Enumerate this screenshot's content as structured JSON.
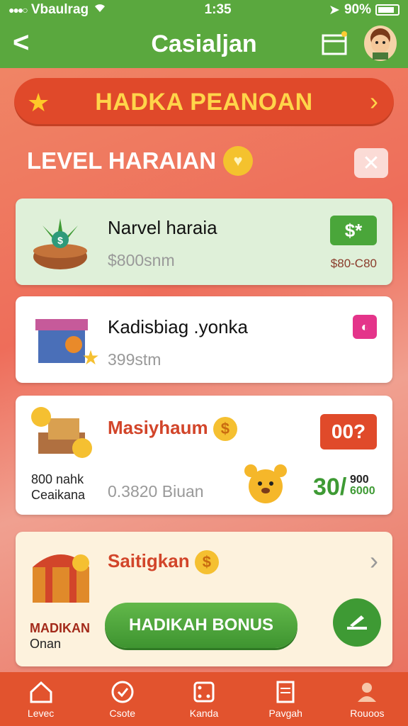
{
  "status": {
    "carrier": "Vbaulrag",
    "time": "1:35",
    "battery": "90%"
  },
  "nav": {
    "back": "<",
    "title": "Casialjan"
  },
  "banner": {
    "title": "HADKA PEANOAN"
  },
  "section": {
    "title": "LEVEL HARAIAN"
  },
  "cards": [
    {
      "title": "Narvel haraia",
      "sub": "$800snm",
      "price": "$*",
      "note": "$80-C80"
    },
    {
      "title": "Kadisbiag .yonka",
      "sub": "399stm"
    },
    {
      "title": "Masiyhaum",
      "sub": "0.3820 Biuan",
      "badge": "00?",
      "left_line1": "800 nahk",
      "left_line2": "Ceaikana",
      "price_big": "30/",
      "price_top": "900",
      "price_bottom": "6000"
    },
    {
      "title": "Saitigkan",
      "left_line1": "MADIKAN",
      "left_line2": "Onan",
      "button": "HADIKAH BONUS"
    }
  ],
  "tabs": [
    {
      "label": "Levec",
      "icon": "home-icon"
    },
    {
      "label": "Csote",
      "icon": "clock-check-icon"
    },
    {
      "label": "Kanda",
      "icon": "dice-icon"
    },
    {
      "label": "Pavgah",
      "icon": "document-icon"
    },
    {
      "label": "Rouoos",
      "icon": "profile-icon"
    }
  ],
  "colors": {
    "green": "#5aa83e",
    "red": "#e0492a",
    "gold": "#ffd54a",
    "orange_tab": "#e2532e"
  }
}
